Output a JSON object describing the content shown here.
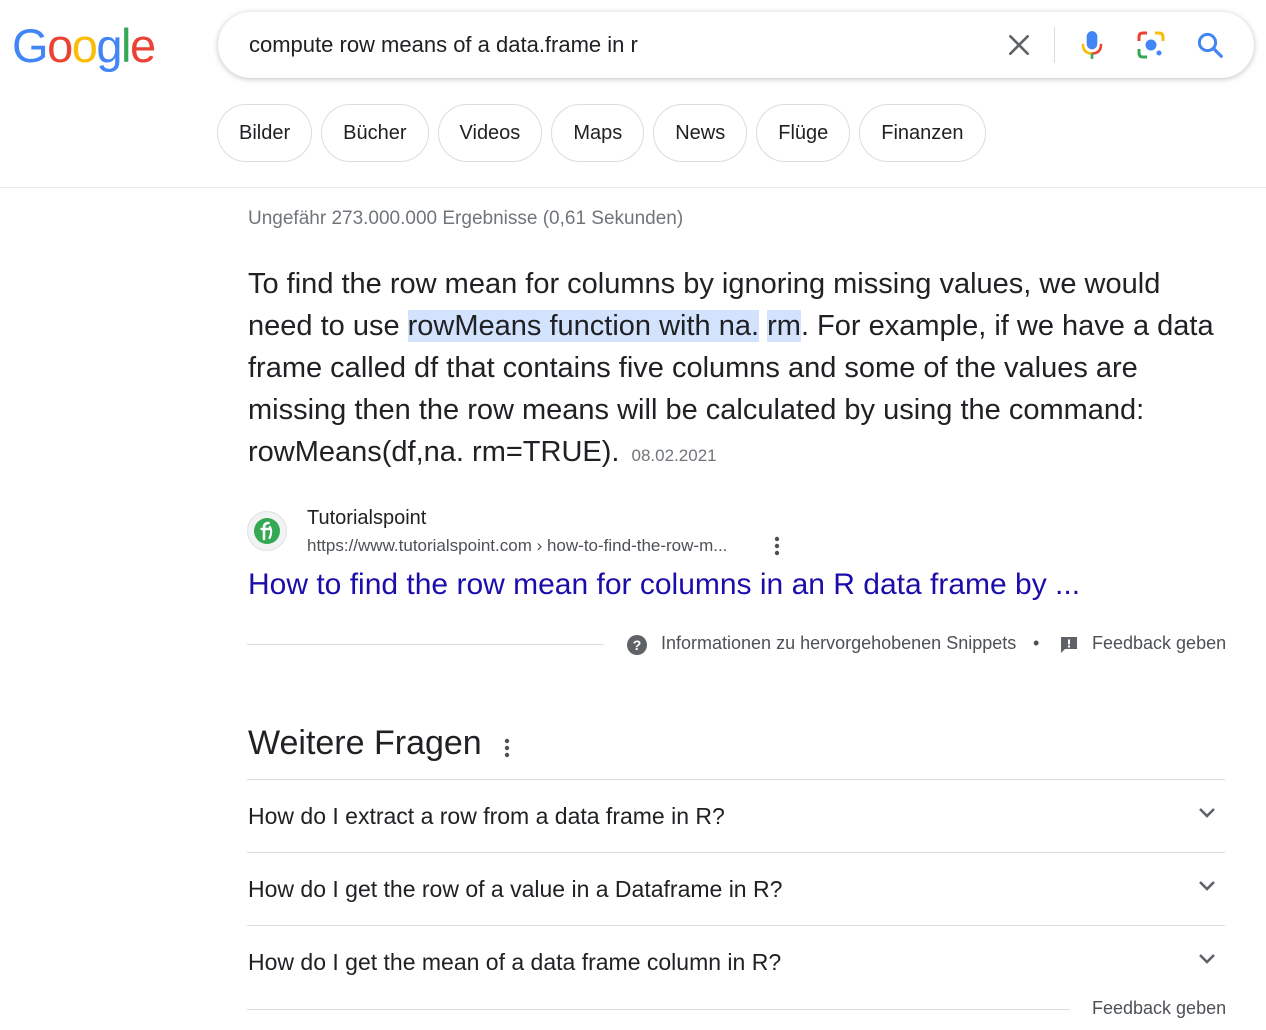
{
  "logo": [
    "G",
    "o",
    "o",
    "g",
    "l",
    "e"
  ],
  "colors": {
    "blue": "#4285F4",
    "red": "#EA4335",
    "yellow": "#FBBC05",
    "green": "#34A853",
    "link": "#1a0dab"
  },
  "search": {
    "query": "compute row means of a data.frame in r"
  },
  "chips": [
    "Bilder",
    "Bücher",
    "Videos",
    "Maps",
    "News",
    "Flüge",
    "Finanzen"
  ],
  "stats": "Ungefähr 273.000.000 Ergebnisse (0,61 Sekunden)",
  "snippet": {
    "part1": "To find the row mean for columns by ignoring missing values, we would need to use ",
    "highlight1": "rowMeans function with na.",
    "space": " ",
    "highlight2": "rm",
    "part2": ". For example, if we have a data frame called df that contains five columns and some of the values are missing then the row means will be calculated by using the command: rowMeans(df,na. rm=TRUE).",
    "date": "08.02.2021"
  },
  "source": {
    "name": "Tutorialspoint",
    "url": "https://www.tutorialspoint.com › how-to-find-the-row-m...",
    "title": "How to find the row mean for columns in an R data frame by ..."
  },
  "snippet_footer": {
    "info": "Informationen zu hervorgehobenen Snippets",
    "dot": "•",
    "feedback": "Feedback geben"
  },
  "paa": {
    "title": "Weitere Fragen",
    "questions": [
      "How do I extract a row from a data frame in R?",
      "How do I get the row of a value in a Dataframe in R?",
      "How do I get the mean of a data frame column in R?"
    ],
    "feedback": "Feedback geben"
  }
}
